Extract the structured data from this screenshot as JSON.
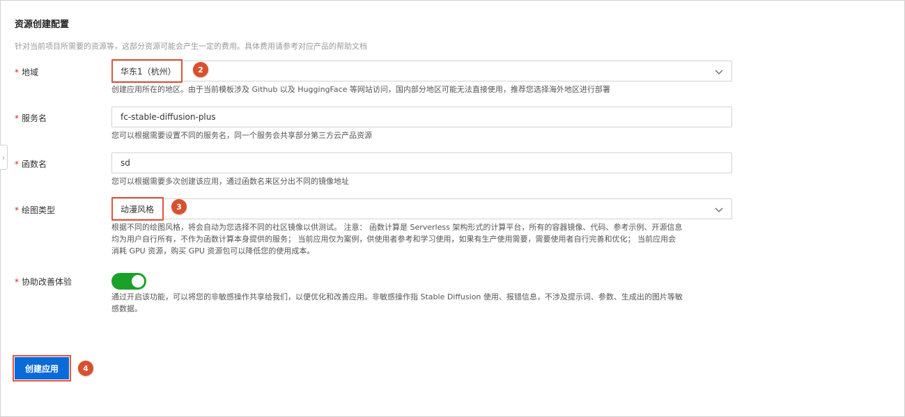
{
  "section": {
    "title": "资源创建配置",
    "description": "针对当前项目所需要的资源等，这部分资源可能会产生一定的费用。具体费用请参考对应产品的帮助文档"
  },
  "fields": {
    "region": {
      "label": "地域",
      "value": "华东1（杭州）",
      "help": "创建应用所在的地区。由于当前模板涉及 Github 以及 HuggingFace 等网站访问，国内部分地区可能无法直接使用，推荐您选择海外地区进行部署"
    },
    "service": {
      "label": "服务名",
      "value": "fc-stable-diffusion-plus",
      "help": "您可以根据需要设置不同的服务名，同一个服务会共享部分第三方云产品资源"
    },
    "function": {
      "label": "函数名",
      "value": "sd",
      "help": "您可以根据需要多次创建该应用，通过函数名来区分出不同的镜像地址"
    },
    "style": {
      "label": "绘图类型",
      "value": "动漫风格",
      "help_line1": "根据不同的绘图风格，将会自动为您选择不同的社区镜像以供测试。 注意： 函数计算是 Serverless 架构形式的计算平台，所有的容器镜像、代码、参考示例、开源信息",
      "help_line2": "均为用户自行所有，不作为函数计算本身提供的服务； 当前应用仅为案例，供使用者参考和学习使用，如果有生产使用需要，需要使用者自行完善和优化； 当前应用会",
      "help_line3": "消耗 GPU 资源，购买 GPU 资源包可以降低您的使用成本。"
    },
    "improve": {
      "label": "协助改善体验",
      "enabled": true,
      "help_line1": "通过开启该功能，可以将您的非敏感操作共享给我们，以便优化和改善应用。非敏感操作指 Stable Diffusion 使用、报错信息，不涉及提示词、参数、生成出的图片等敏",
      "help_line2": "感数据。"
    }
  },
  "required_mark": "*",
  "submit": {
    "label": "创建应用"
  },
  "badges": [
    "2",
    "3",
    "4"
  ],
  "colors": {
    "primary": "#0a6ad8",
    "toggle_on": "#1aa12a",
    "highlight": "#e0553c",
    "badge": "#d8502f",
    "required": "#e02020"
  }
}
